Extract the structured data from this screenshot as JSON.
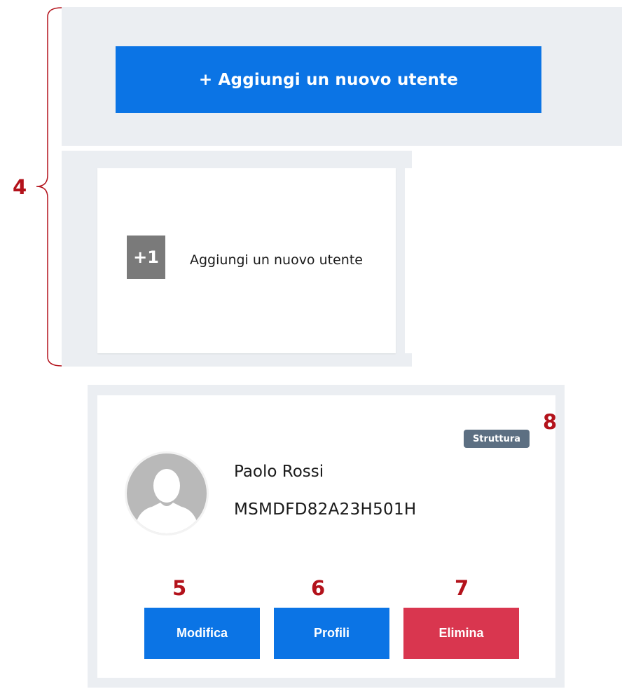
{
  "add_user_banner": {
    "label": "+ Aggiungi un nuovo utente"
  },
  "add_user_card": {
    "counter": "+1",
    "label": "Aggiungi un nuovo utente"
  },
  "user_card": {
    "badge": "Struttura",
    "name": "Paolo Rossi",
    "fiscal_code": "MSMDFD82A23H501H",
    "avatar_icon": "user-avatar-placeholder-icon",
    "actions": {
      "edit": "Modifica",
      "profiles": "Profili",
      "delete": "Elimina"
    }
  },
  "annotations": {
    "group": "4",
    "edit": "5",
    "profiles": "6",
    "delete": "7",
    "badge": "8"
  },
  "colors": {
    "primary": "#0b74e5",
    "danger": "#d9364f",
    "badge": "#5c6f82",
    "panel": "#ebeef2",
    "annotation": "#b3121b"
  }
}
